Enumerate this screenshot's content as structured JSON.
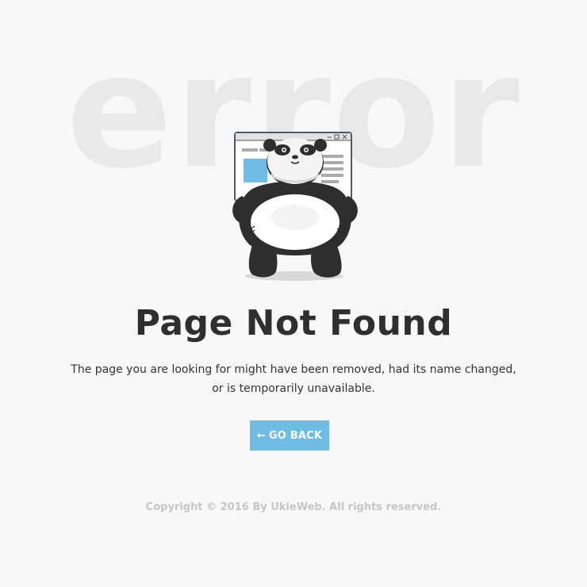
{
  "background": {
    "word": "error",
    "color": "#e8e9eb",
    "page_color": "#f7f8fa"
  },
  "illustration": {
    "icon": "panda-holding-browser-window-icon"
  },
  "main": {
    "title": "Page Not Found",
    "message_line1": "The page you are looking for might have been removed, had its name changed,",
    "message_line2": "or is temporarily unavailable."
  },
  "button": {
    "arrow": "←",
    "label": "GO BACK",
    "color": "#6dbde4"
  },
  "footer": {
    "copyright": "Copyright © 2016 By UkieWeb. All rights reserved."
  }
}
